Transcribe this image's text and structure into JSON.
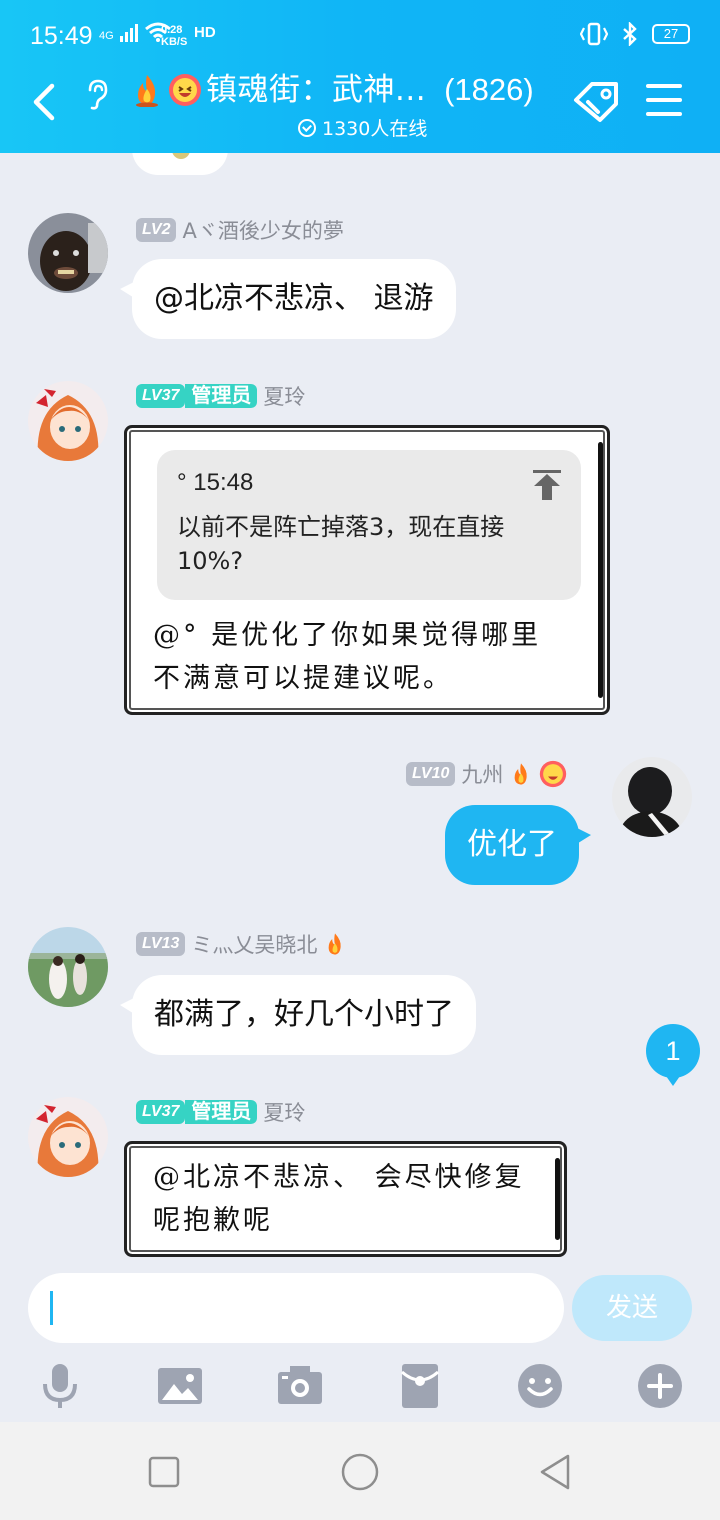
{
  "status_bar": {
    "time": "15:49",
    "network_label": "4G",
    "speed_value": "0.28",
    "speed_unit": "KB/S",
    "hd_label": "HD",
    "battery": "27"
  },
  "header": {
    "title": "镇魂街：武神...",
    "member_count": "(1826)",
    "online_text": "1330人在线",
    "accent_color": "#10b5f6"
  },
  "messages": [
    {
      "level": "LV2",
      "sender": "Aヾ酒後少女的夢",
      "text": "@北凉不悲凉、 退游",
      "side": "left"
    },
    {
      "level": "LV37",
      "role": "管理员",
      "sender": "夏玲",
      "quote_name": "° 15:48",
      "quote_text": "以前不是阵亡掉落3，现在直接10%?",
      "text": "@° 是优化了你如果觉得哪里不满意可以提建议呢。",
      "side": "left"
    },
    {
      "level": "LV10",
      "sender": "九州",
      "text": "优化了",
      "side": "right"
    },
    {
      "level": "LV13",
      "sender": "ミ灬乂吴晓北",
      "text": "都满了，好几个小时了",
      "side": "left"
    },
    {
      "level": "LV37",
      "role": "管理员",
      "sender": "夏玲",
      "text": "@北凉不悲凉、 会尽快修复呢抱歉呢",
      "side": "left"
    }
  ],
  "unread_count": "1",
  "composer": {
    "send_label": "发送"
  },
  "toolbar_icons": [
    "microphone-icon",
    "image-icon",
    "camera-icon",
    "red-packet-icon",
    "emoji-icon",
    "plus-icon"
  ],
  "navbar_icons": [
    "recent-apps-icon",
    "home-icon",
    "back-icon"
  ]
}
